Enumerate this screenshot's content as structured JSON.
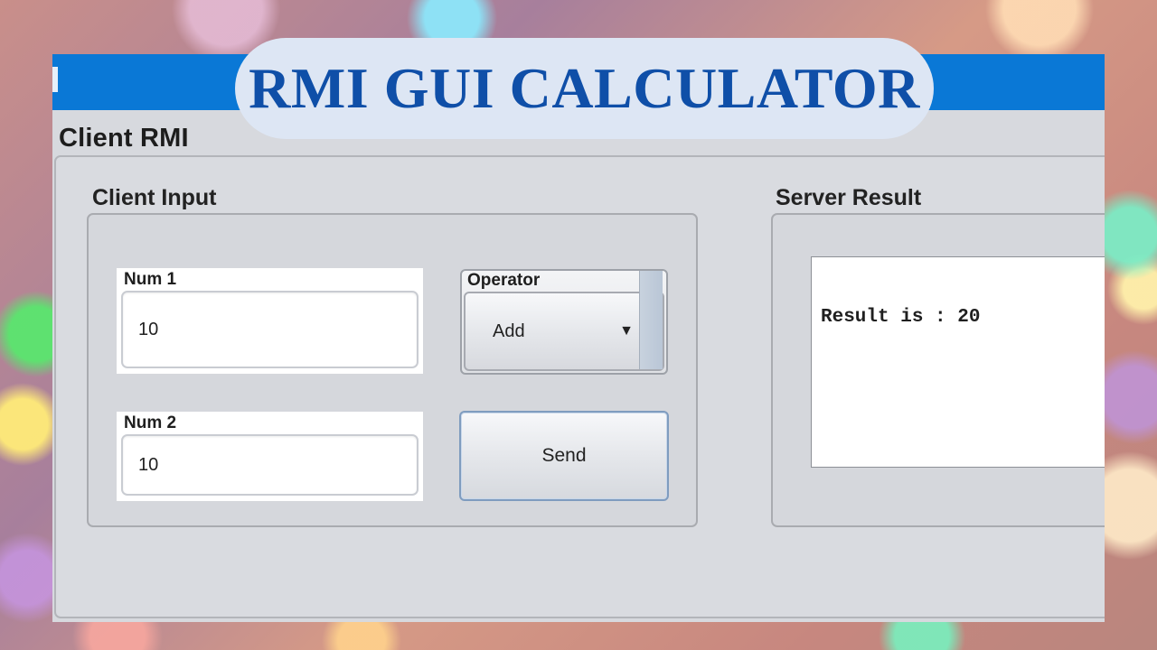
{
  "banner": {
    "title": "RMI GUI CALCULATOR"
  },
  "window": {
    "heading": "Client RMI"
  },
  "client_input": {
    "group_title": "Client Input",
    "num1": {
      "label": "Num 1",
      "value": "10"
    },
    "num2": {
      "label": "Num 2",
      "value": "10"
    },
    "operator": {
      "label": "Operator",
      "selected": "Add",
      "arrow": "▼"
    },
    "send_label": "Send"
  },
  "server_result": {
    "group_title": "Server Result",
    "text": "Result is : 20"
  },
  "colors": {
    "titlebar": "#0a78d6",
    "banner_bg": "#dde6f4",
    "banner_text": "#0f4fa8"
  }
}
